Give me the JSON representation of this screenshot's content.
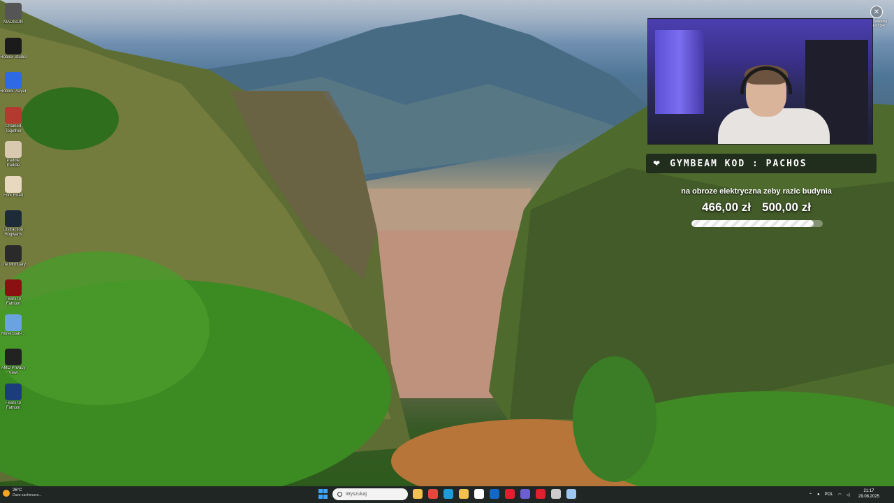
{
  "desktop": {
    "icons": [
      {
        "label": "MADISON",
        "icon": "madison-icon",
        "color": "#555555"
      },
      {
        "label": "Roblox Studio",
        "icon": "roblox-studio-icon",
        "color": "#1b1b1b"
      },
      {
        "label": "Roblox Player",
        "icon": "roblox-player-icon",
        "color": "#2d6ae3"
      },
      {
        "label": "Chained Together",
        "icon": "chained-together-icon",
        "color": "#b33a2e"
      },
      {
        "label": "Paddle Paddle",
        "icon": "paddle-icon",
        "color": "#d9c9b0"
      },
      {
        "label": "Fork Road",
        "icon": "fork-road-icon",
        "color": "#e8d8c0"
      },
      {
        "label": "Distraction Hogwarts",
        "icon": "hogwarts-icon",
        "color": "#1d2a3a"
      },
      {
        "label": "The Mortuary",
        "icon": "mortuary-icon",
        "color": "#2a2a2a"
      },
      {
        "label": "Fears to Fathom",
        "icon": "fears-to-fathom-icon",
        "color": "#8a1111"
      },
      {
        "label": "MoveStarP...",
        "icon": "movestar-icon",
        "color": "#6aa3e0"
      },
      {
        "label": "AMD Privacy View",
        "icon": "privacy-view-icon",
        "color": "#222222"
      },
      {
        "label": "Fears to Fathom",
        "icon": "fears-to-fathom-2-icon",
        "color": "#1b3e7a"
      }
    ]
  },
  "overlay": {
    "sponsor_text": "GYMBEAM KOD : PACHOS",
    "goal_title": "na obroze elektryczna zeby razic budynia",
    "goal_current": "466,00 zł",
    "goal_target": "500,00 zł",
    "goal_progress": 0.932,
    "corner_label": "Zeskanuj kod QR",
    "corner_icon": "close-circle-icon"
  },
  "taskbar": {
    "weather_temp": "26°C",
    "weather_cond": "Duże zachmurze...",
    "search_placeholder": "Wyszukaj",
    "apps": [
      {
        "icon": "file-explorer-icon",
        "color": "#f2c14e"
      },
      {
        "icon": "chrome-icon",
        "color": "#e8453c"
      },
      {
        "icon": "edge-icon",
        "color": "#1f9bd7"
      },
      {
        "icon": "folder-icon",
        "color": "#f2c14e"
      },
      {
        "icon": "store-icon",
        "color": "#ffffff"
      },
      {
        "icon": "outlook-icon",
        "color": "#1168c7"
      },
      {
        "icon": "opera-icon",
        "color": "#e0202e"
      },
      {
        "icon": "teams-icon",
        "color": "#6b5fd1"
      },
      {
        "icon": "opera-gx-icon",
        "color": "#e0202e"
      },
      {
        "icon": "obs-icon",
        "color": "#cccccc"
      },
      {
        "icon": "steam-icon",
        "color": "#9fc8f0"
      }
    ],
    "language": "POL",
    "time": "21:17",
    "date": "29.08.2025"
  }
}
